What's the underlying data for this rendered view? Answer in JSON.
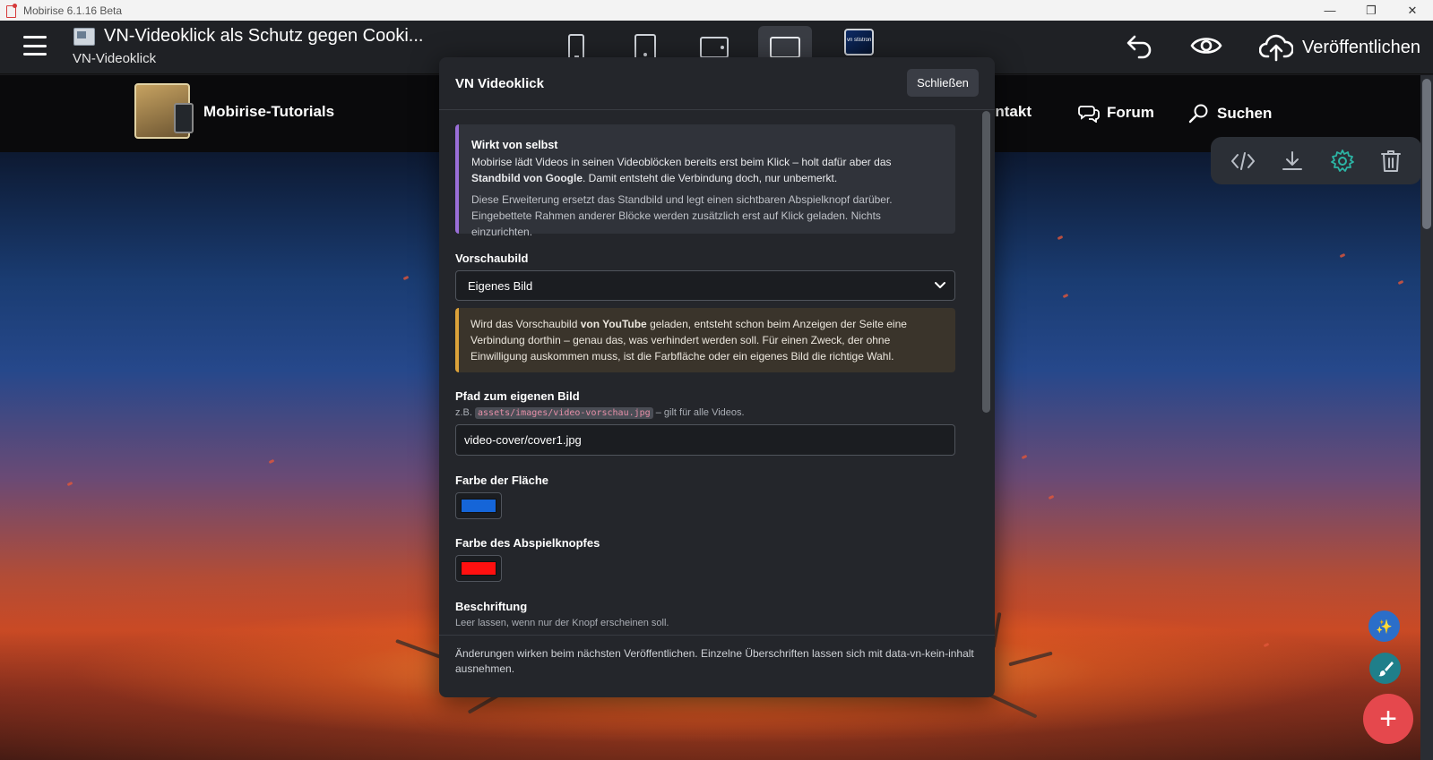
{
  "window": {
    "app_title": "Mobirise 6.1.16 Beta",
    "minimize": "—",
    "maximize": "❐",
    "close": "✕"
  },
  "topbar": {
    "page_title": "VN-Videoklick als Schutz gegen Cooki...",
    "page_subtitle": "VN-Videoklick",
    "theme_thumb_label": "vn stistron",
    "publish_label": "Veröffentlichen"
  },
  "site": {
    "brand": "Mobirise-Tutorials",
    "nav": [
      "ontakt",
      "Forum",
      "Suchen"
    ]
  },
  "modal": {
    "title": "VN Videoklick",
    "close_label": "Schließen",
    "info": {
      "title": "Wirkt von selbst",
      "p1_a": "Mobirise lädt Videos in seinen Videoblöcken bereits erst beim Klick – holt dafür aber das ",
      "p1_b": "Standbild von Google",
      "p1_c": ". Damit entsteht die Verbindung doch, nur unbemerkt.",
      "p2": "Diese Erweiterung ersetzt das Standbild und legt einen sichtbaren Abspielknopf darüber. Eingebettete Rahmen anderer Blöcke werden zusätzlich erst auf Klick geladen. Nichts einzurichten."
    },
    "preview_label": "Vorschaubild",
    "preview_value": "Eigenes Bild",
    "warning": {
      "a": "Wird das Vorschaubild ",
      "b": "von YouTube",
      "c": " geladen, entsteht schon beim Anzeigen der Seite eine Verbindung dorthin – genau das, was verhindert werden soll. Für einen Zweck, der ohne Einwilligung auskommen muss, ist die Farbfläche oder ein eigenes Bild die richtige Wahl."
    },
    "path_label": "Pfad zum eigenen Bild",
    "path_hint_a": "z.B. ",
    "path_hint_code": "assets/images/video-vorschau.jpg",
    "path_hint_b": " – gilt für alle Videos.",
    "path_value": "video-cover/cover1.jpg",
    "area_color_label": "Farbe der Fläche",
    "area_color": "#1565d8",
    "play_color_label": "Farbe des Abspielknopfes",
    "play_color": "#ff1010",
    "caption_label": "Beschriftung",
    "caption_hint": "Leer lassen, wenn nur der Knopf erscheinen soll.",
    "footer": "Änderungen wirken beim nächsten Veröffentlichen. Einzelne Überschriften lassen sich mit data-vn-kein-inhalt ausnehmen."
  },
  "fabs": {
    "ai_icon": "✨",
    "add_icon": "+"
  },
  "colors": {
    "accent": "#2cb5a5",
    "fab_add": "#e5484d",
    "fab_ai": "#2b6ec9",
    "fab_brush": "#1f7f8a"
  }
}
